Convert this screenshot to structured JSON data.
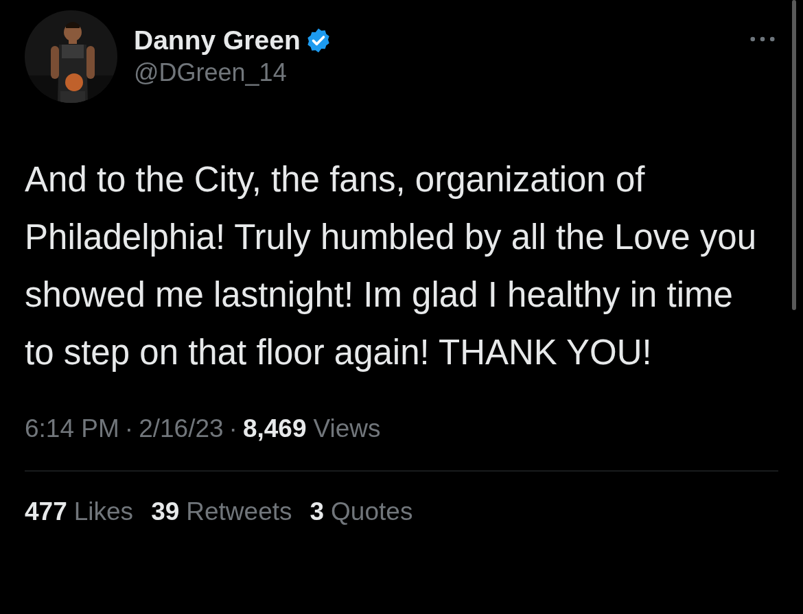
{
  "author": {
    "name": "Danny Green",
    "handle": "@DGreen_14",
    "verified": true
  },
  "text": "And to the City, the fans, organization of Philadelphia! Truly humbled by all the Love you showed me lastnight! Im glad I healthy in time to step on that floor again! THANK YOU!",
  "time": "6:14 PM",
  "separator": "·",
  "date": "2/16/23",
  "views": {
    "count": "8,469",
    "label": "Views"
  },
  "stats": [
    {
      "count": "477",
      "label": "Likes"
    },
    {
      "count": "39",
      "label": "Retweets"
    },
    {
      "count": "3",
      "label": "Quotes"
    }
  ]
}
